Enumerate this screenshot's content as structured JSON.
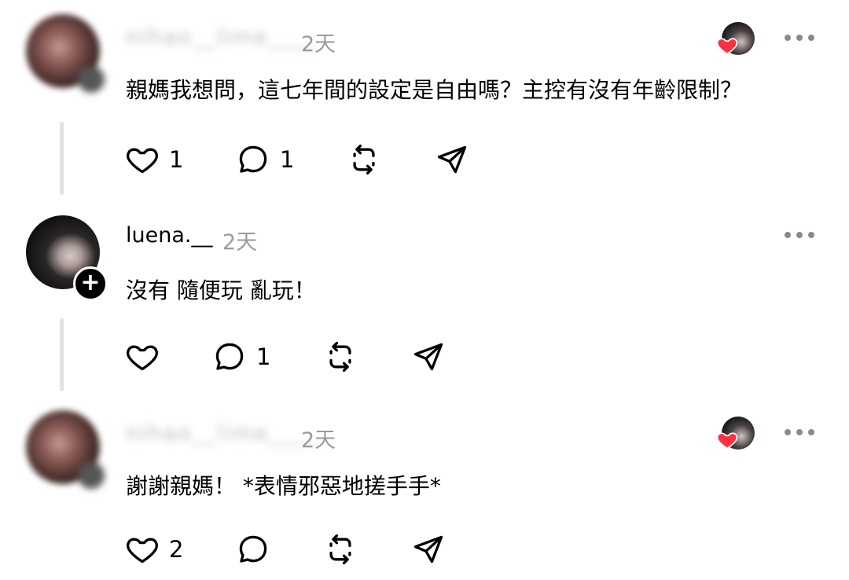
{
  "comments": [
    {
      "username": "nihao__lime____",
      "time": "2天",
      "text": "親媽我想問，這七年間的設定是自由嗎？主控有沒有年齡限制？",
      "like_count": "1",
      "reply_count": "1",
      "liked_by_author": true
    },
    {
      "username": "luena.__",
      "time": "2天",
      "text": "沒有 隨便玩 亂玩！",
      "like_count": "",
      "reply_count": "1",
      "liked_by_author": false
    },
    {
      "username": "nihao__lime____",
      "time": "2天",
      "text": "謝謝親媽！ *表情邪惡地搓手手*",
      "like_count": "2",
      "reply_count": "",
      "liked_by_author": true
    }
  ],
  "icons": {
    "like": "heart-outline-icon",
    "reply": "speech-bubble-icon",
    "repost": "repost-arrows-icon",
    "share": "paper-plane-icon",
    "more": "more-dots-icon",
    "follow": "plus-icon",
    "liked": "red-heart-icon"
  },
  "colors": {
    "text": "#000000",
    "secondary": "#9a9a9a",
    "thread_line": "#e2e2e2",
    "heart": "#ff3040"
  }
}
